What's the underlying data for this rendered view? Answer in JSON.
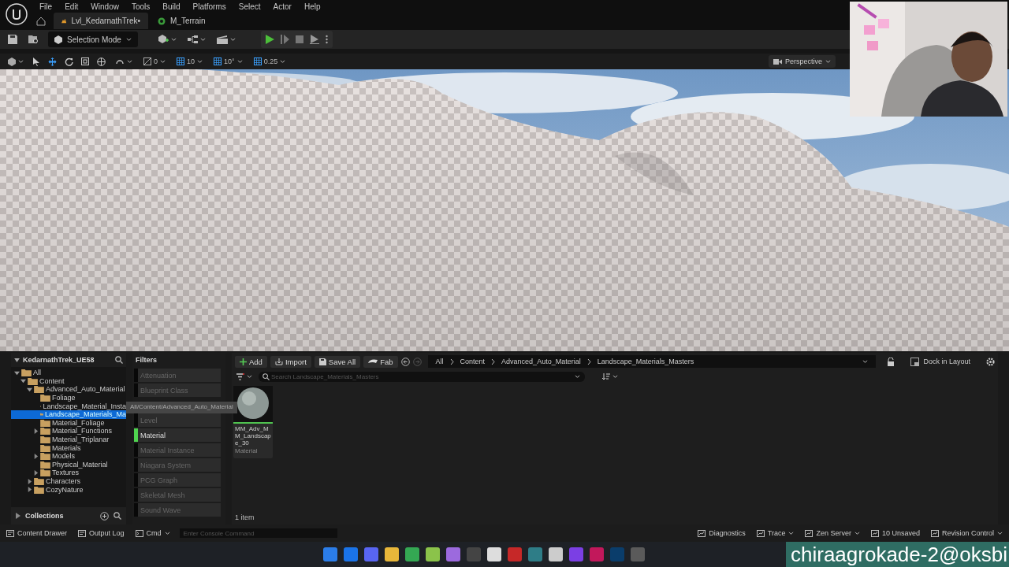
{
  "menu": [
    "File",
    "Edit",
    "Window",
    "Tools",
    "Build",
    "Platforms",
    "Select",
    "Actor",
    "Help"
  ],
  "tabs": [
    {
      "label": "Lvl_KedarnathTrek•",
      "selected": true
    },
    {
      "label": "M_Terrain",
      "selected": false
    }
  ],
  "toolbar": {
    "mode": "Selection Mode"
  },
  "viewport_toolbar": {
    "snap_values": [
      "0",
      "10",
      "10°",
      "0.25"
    ],
    "view": "Perspective"
  },
  "content_browser": {
    "project": "KedarnathTrek_UE58",
    "tree": [
      {
        "label": "All",
        "expanded": true,
        "selected": false,
        "children": [
          {
            "label": "Content",
            "expanded": true,
            "selected": false,
            "children": [
              {
                "label": "Advanced_Auto_Material",
                "expanded": true,
                "selected": false,
                "children": [
                  {
                    "label": "Foliage",
                    "selected": false
                  },
                  {
                    "label": "Landscape_Material_Insta",
                    "selected": false
                  },
                  {
                    "label": "Landscape_Materials_Ma",
                    "selected": true
                  },
                  {
                    "label": "Material_Foliage",
                    "selected": false
                  },
                  {
                    "label": "Material_Functions",
                    "expanded": false,
                    "selected": false
                  },
                  {
                    "label": "Material_Triplanar",
                    "selected": false
                  },
                  {
                    "label": "Materials",
                    "selected": false
                  },
                  {
                    "label": "Models",
                    "expanded": false,
                    "selected": false
                  },
                  {
                    "label": "Physical_Material",
                    "selected": false
                  },
                  {
                    "label": "Textures",
                    "expanded": false,
                    "selected": false
                  }
                ]
              },
              {
                "label": "Characters",
                "expanded": false,
                "selected": false
              },
              {
                "label": "CozyNature",
                "expanded": false,
                "selected": false
              }
            ]
          }
        ]
      }
    ],
    "collections": "Collections",
    "filters_title": "Filters",
    "filters": [
      {
        "label": "Attenuation",
        "checked": false
      },
      {
        "label": "Blueprint Class",
        "checked": false
      },
      {
        "label": "Level",
        "checked": false
      },
      {
        "label": "Material",
        "checked": true
      },
      {
        "label": "Material Instance",
        "checked": false
      },
      {
        "label": "Niagara System",
        "checked": false
      },
      {
        "label": "PCG Graph",
        "checked": false
      },
      {
        "label": "Skeletal Mesh",
        "checked": false
      },
      {
        "label": "Sound Wave",
        "checked": false
      }
    ],
    "actions": [
      "Add",
      "Import",
      "Save All",
      "Fab"
    ],
    "breadcrumb": [
      "All",
      "Content",
      "Advanced_Auto_Material",
      "Landscape_Materials_Masters"
    ],
    "search": {
      "placeholder": "Search Landscape_Materials_Masters"
    },
    "dock": "Dock in Layout",
    "assets": [
      {
        "name": "MM_Adv_MM_Landscape_30",
        "type": "Material"
      }
    ],
    "item_count": "1 item",
    "drag_tooltip": "All/Content/Advanced_Auto_Material"
  },
  "status_bar": {
    "left": [
      "Content Drawer",
      "Output Log"
    ],
    "cmd": "Cmd",
    "console_placeholder": "Enter Console Command",
    "right": [
      "Diagnostics",
      "Trace",
      "Zen Server",
      "10 Unsaved",
      "Revision Control"
    ]
  },
  "overlay_text": "chiraagrokade-2@oksbi"
}
